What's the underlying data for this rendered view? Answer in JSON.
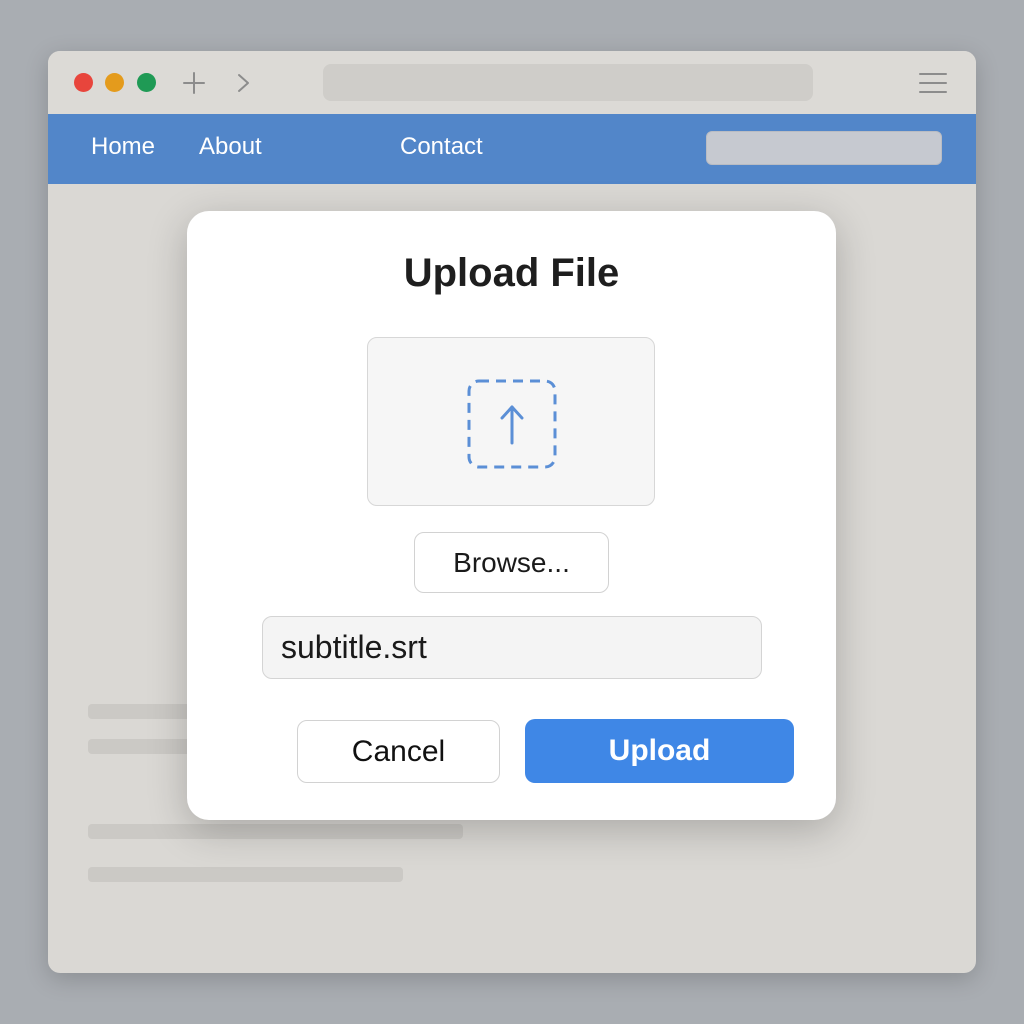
{
  "browser": {
    "traffic_lights": {
      "close_color": "#e8453c",
      "minimize_color": "#e49b1c",
      "maximize_color": "#1f9a55"
    },
    "icons": [
      "plus-icon",
      "chevron-right-icon",
      "menu-icon"
    ]
  },
  "navbar": {
    "background_color": "#5286c9",
    "links": [
      {
        "label": "Home"
      },
      {
        "label": "About"
      },
      {
        "label": "Contact"
      }
    ]
  },
  "dialog": {
    "title": "Upload File",
    "dropzone_icon": "upload-arrow-icon",
    "accent_color": "#5b8fd6",
    "browse_label": "Browse...",
    "filename_value": "subtitle.srt",
    "cancel_label": "Cancel",
    "upload_label": "Upload",
    "upload_color": "#3f87e6"
  }
}
